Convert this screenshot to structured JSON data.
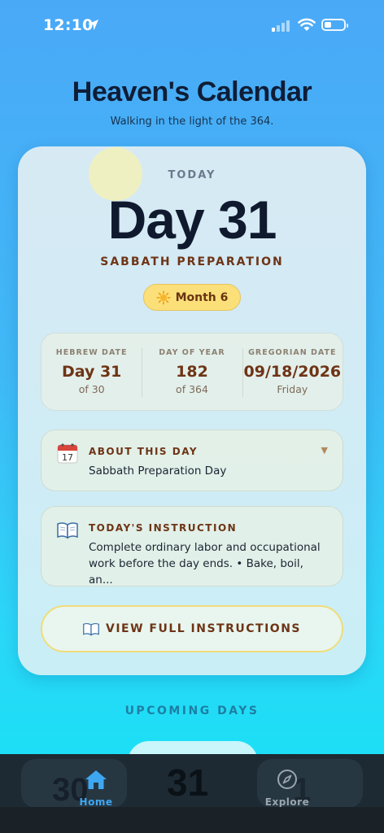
{
  "status_bar": {
    "time": "12:10"
  },
  "header": {
    "title": "Heaven's Calendar",
    "subtitle": "Walking in the light of the 364."
  },
  "today_card": {
    "label": "TODAY",
    "day": "Day 31",
    "day_type": "SABBATH PREPARATION",
    "month_badge": "Month 6",
    "month_icon": "sun-icon"
  },
  "stats": [
    {
      "label": "HEBREW DATE",
      "value": "Day 31",
      "sub": "of 30"
    },
    {
      "label": "DAY OF YEAR",
      "value": "182",
      "sub": "of 364"
    },
    {
      "label": "GREGORIAN DATE",
      "value": "09/18/2026",
      "sub": "Friday"
    }
  ],
  "about": {
    "icon": "calendar-icon",
    "heading": "ABOUT THIS DAY",
    "text": "Sabbath Preparation Day"
  },
  "instruction": {
    "icon": "book-icon",
    "heading": "TODAY'S INSTRUCTION",
    "text": "Complete ordinary labor and occupational work before the day ends. • Bake, boil, an..."
  },
  "view_button": {
    "label": "VIEW FULL INSTRUCTIONS",
    "icon": "book-icon"
  },
  "upcoming": {
    "heading": "UPCOMING DAYS",
    "center_day": "31",
    "left_day": "30",
    "right_day": "1"
  },
  "tabs": [
    {
      "label": "Home",
      "icon": "house-icon",
      "active": true
    },
    {
      "label": "Explore",
      "icon": "compass-icon",
      "active": false
    }
  ],
  "colors": {
    "accent_brown": "#6e3416",
    "badge_yellow": "#fbe07a",
    "tab_active": "#3ea7f2"
  }
}
